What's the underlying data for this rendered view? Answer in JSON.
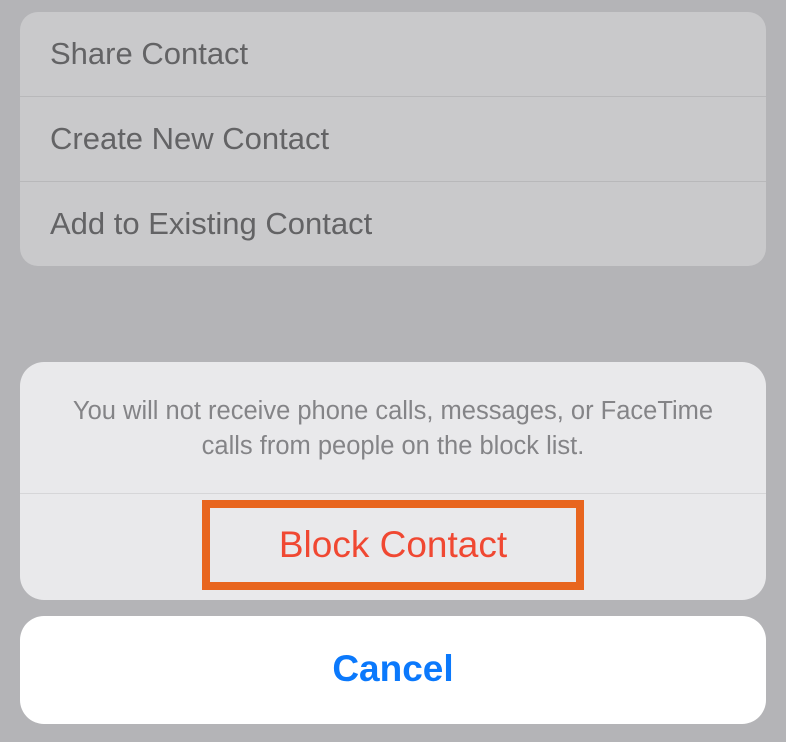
{
  "background": {
    "items": [
      "Share Contact",
      "Create New Contact",
      "Add to Existing Contact"
    ]
  },
  "actionSheet": {
    "message": "You will not receive phone calls, messages, or FaceTime calls from people on the block list.",
    "destructiveAction": "Block Contact",
    "cancel": "Cancel"
  }
}
